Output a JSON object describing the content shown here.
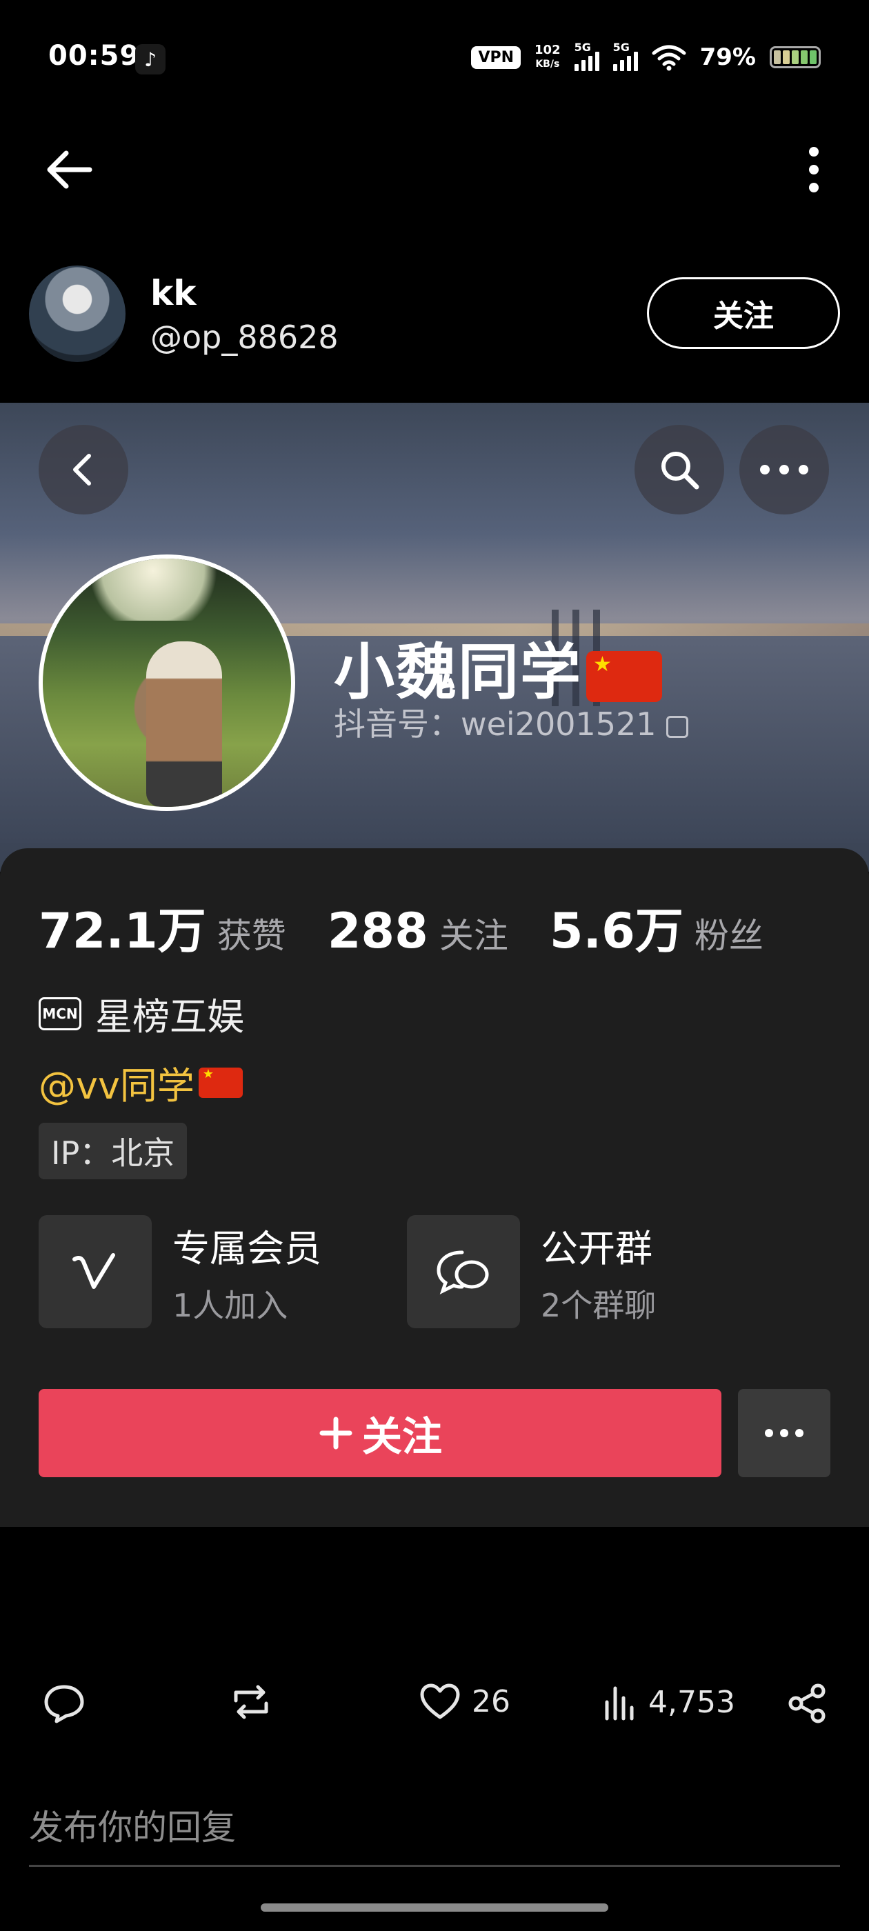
{
  "status_bar": {
    "time": "00:59",
    "vpn": "VPN",
    "speed_value": "102",
    "speed_unit": "KB/s",
    "sig1": "5G",
    "sig2": "5G",
    "battery": "79%",
    "app_badge_icon": "tiktok-icon"
  },
  "post": {
    "author_name": "kk",
    "author_handle": "@op_88628",
    "follow_label": "关注"
  },
  "profile_card": {
    "nickname": "小魏同学",
    "douyin_id": "抖音号：wei2001521",
    "stats": [
      {
        "value": "72.1万",
        "label": "获赞"
      },
      {
        "value": "288",
        "label": "关注"
      },
      {
        "value": "5.6万",
        "label": "粉丝"
      }
    ],
    "mcn_badge": "MCN",
    "mcn_name": "星榜互娱",
    "mention": "@vv同学",
    "ip": "IP：北京",
    "features": [
      {
        "title": "专属会员",
        "sub": "1人加入",
        "icon": "v-membership-icon"
      },
      {
        "title": "公开群",
        "sub": "2个群聊",
        "icon": "chat-bubbles-icon"
      }
    ],
    "follow_button": "关注",
    "colors": {
      "follow_red": "#ea445a",
      "mention_yellow": "#f3c340",
      "panel_bg": "#1e1e1e"
    }
  },
  "actions": {
    "likes": "26",
    "views": "4,753"
  },
  "reply_placeholder": "发布你的回复"
}
